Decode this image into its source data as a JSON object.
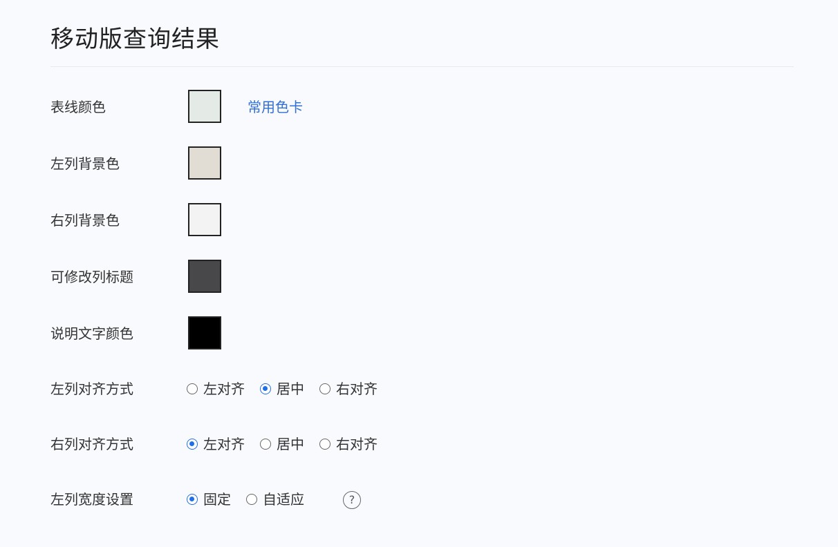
{
  "page": {
    "title": "移动版查询结果"
  },
  "colors": {
    "accent": "#1f6fe5",
    "link": "#2f6fd6"
  },
  "color_settings": [
    {
      "label": "表线颜色",
      "swatch": "#e4ebe7",
      "link": "常用色卡"
    },
    {
      "label": "左列背景色",
      "swatch": "#e1ddd4"
    },
    {
      "label": "右列背景色",
      "swatch": "#f3f3f3"
    },
    {
      "label": "可修改列标题",
      "swatch": "#48484a"
    },
    {
      "label": "说明文字颜色",
      "swatch": "#000000"
    }
  ],
  "radio_settings": [
    {
      "label": "左列对齐方式",
      "options": [
        "左对齐",
        "居中",
        "右对齐"
      ],
      "selected": "居中"
    },
    {
      "label": "右列对齐方式",
      "options": [
        "左对齐",
        "居中",
        "右对齐"
      ],
      "selected": "左对齐"
    },
    {
      "label": "左列宽度设置",
      "options": [
        "固定",
        "自适应"
      ],
      "selected": "固定"
    }
  ],
  "help": {
    "icon": "question-circle-icon",
    "glyph": "?"
  }
}
